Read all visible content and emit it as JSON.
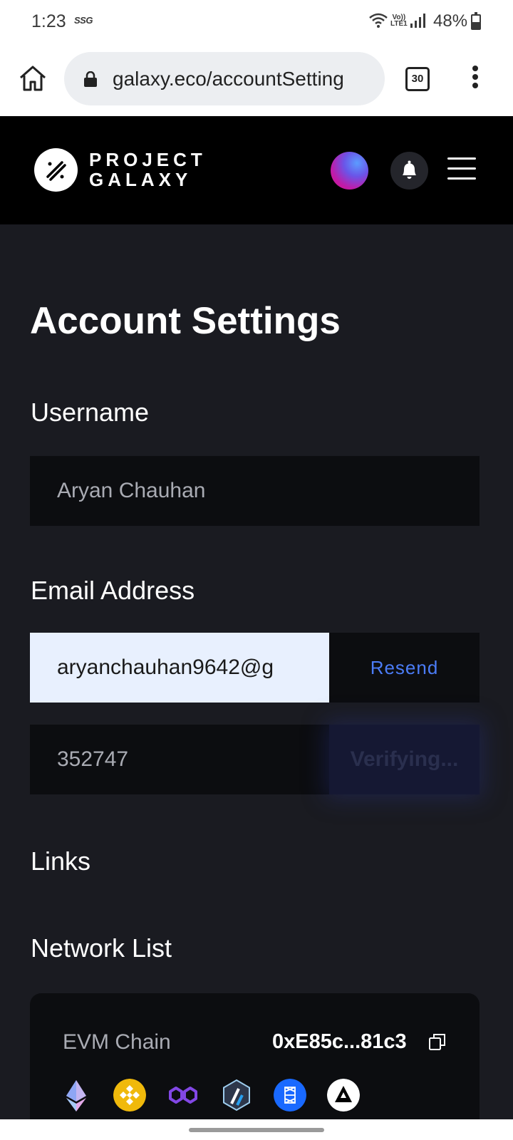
{
  "status_bar": {
    "time": "1:23",
    "carrier_icon": "SSG",
    "volte_line1": "Vo))",
    "volte_line2": "LTE1",
    "battery_percent": "48%",
    "battery_level": 0.48,
    "icons": [
      "wifi-icon",
      "signal-icon",
      "battery-icon"
    ]
  },
  "browser": {
    "url": "galaxy.eco/accountSetting",
    "tab_count": "30",
    "icons": [
      "home-icon",
      "lock-icon",
      "more-vert-icon"
    ]
  },
  "site_header": {
    "logo_line1": "PROJECT",
    "logo_line2": "GALAXY",
    "icons": [
      "galaxy-logo-icon",
      "avatar",
      "bell-icon",
      "hamburger-icon"
    ]
  },
  "main": {
    "title": "Account Settings",
    "username_label": "Username",
    "username_value": "Aryan Chauhan",
    "email_label": "Email Address",
    "email_value": "aryanchauhan9642@g",
    "resend_label": "Resend",
    "code_value": "352747",
    "verify_label": "Verifying...",
    "links_label": "Links",
    "network_list_label": "Network List"
  },
  "network": {
    "chain_name": "EVM Chain",
    "address": "0xE85c...81c3",
    "chains": [
      "ethereum-icon",
      "bnb-chain-icon",
      "polygon-icon",
      "arbitrum-icon",
      "fantom-icon",
      "avalanche-icon"
    ]
  },
  "colors": {
    "page_bg": "#1a1b21",
    "header_bg": "#000000",
    "input_bg": "#0c0d10",
    "accent_blue": "#4b7cf7",
    "autofill_bg": "#e8f0fe"
  }
}
